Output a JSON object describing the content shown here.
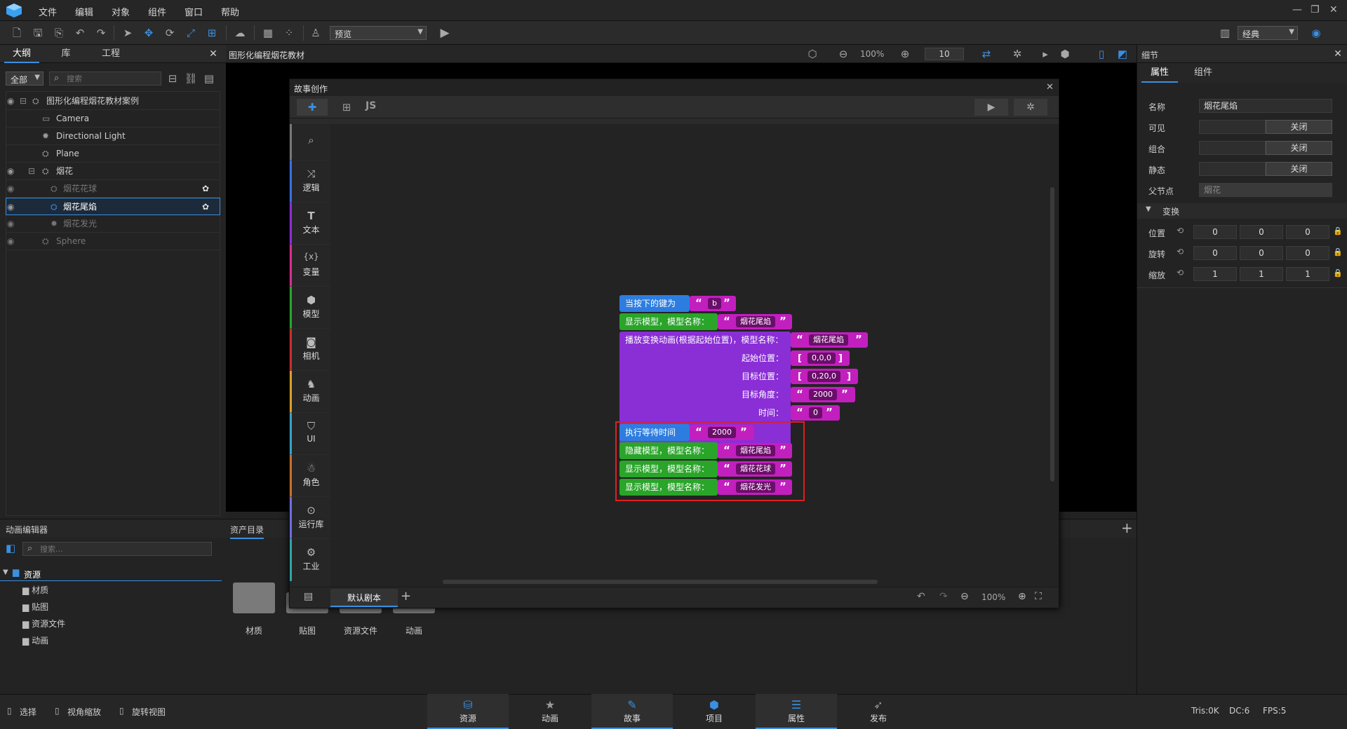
{
  "menu": [
    "文件",
    "编辑",
    "对象",
    "组件",
    "窗口",
    "帮助"
  ],
  "toolbar": {
    "preview_label": "预览",
    "layout_label": "经典"
  },
  "left_panel": {
    "tabs": [
      "大纲",
      "库",
      "工程"
    ],
    "filter": "全部",
    "search_placeholder": "搜索",
    "tree": [
      {
        "label": "图形化编程烟花教材案例",
        "level": 0
      },
      {
        "label": "Camera",
        "level": 1
      },
      {
        "label": "Directional Light",
        "level": 1
      },
      {
        "label": "Plane",
        "level": 1
      },
      {
        "label": "烟花",
        "level": 1
      },
      {
        "label": "烟花花球",
        "level": 2
      },
      {
        "label": "烟花尾焰",
        "level": 2
      },
      {
        "label": "烟花发光",
        "level": 2
      },
      {
        "label": "Sphere",
        "level": 1
      }
    ]
  },
  "scene_header": {
    "title": "图形化编程烟花教材",
    "zoom": "100%",
    "grid_value": "10"
  },
  "story_dialog": {
    "title": "故事创作",
    "js_label": "JS",
    "categories": [
      "逻辑",
      "文本",
      "变量",
      "模型",
      "相机",
      "动画",
      "UI",
      "角色",
      "运行库",
      "工业"
    ],
    "blocks": {
      "on_key": "当按下的键为",
      "key_value": "b",
      "show_model": "显示模型，模型名称：",
      "tail_flame": "烟花尾焰",
      "play_anim": "播放变换动画(根据起始位置)，模型名称：",
      "start_pos": "起始位置：",
      "start_pos_value": "0,0,0",
      "target_pos": "目标位置：",
      "target_pos_value": "0,20,0",
      "target_angle": "目标角度：",
      "target_angle_value": "2000",
      "time": "时间：",
      "time_value": "0",
      "wait": "执行等待时间",
      "wait_value": "2000",
      "hide_model": "隐藏模型，模型名称：",
      "flower_ball": "烟花花球",
      "glow": "烟花发光"
    },
    "script_tab": "默认剧本",
    "zoom": "100%"
  },
  "right_panel": {
    "title": "细节",
    "tabs": [
      "属性",
      "组件"
    ],
    "name_label": "名称",
    "name_value": "烟花尾焰",
    "visible_label": "可见",
    "group_label": "组合",
    "static_label": "静态",
    "off_label": "关闭",
    "parent_label": "父节点",
    "parent_value": "烟花",
    "transform_label": "变换",
    "position_label": "位置",
    "rotation_label": "旋转",
    "scale_label": "缩放",
    "position": [
      "0",
      "0",
      "0"
    ],
    "rotation": [
      "0",
      "0",
      "0"
    ],
    "scale": [
      "1",
      "1",
      "1"
    ]
  },
  "anim_panel": {
    "title": "动画编辑器",
    "search_placeholder": "搜索..."
  },
  "assets": {
    "tab": "资产目录",
    "tree_root": "资源",
    "tree": [
      "材质",
      "贴图",
      "资源文件",
      "动画"
    ],
    "folders": [
      "材质",
      "贴图",
      "资源文件",
      "动画"
    ]
  },
  "status": {
    "select": "选择",
    "view_zoom": "视角缩放",
    "rotate_view": "旋转视图",
    "tris": "Tris:0K",
    "dc": "DC:6",
    "fps": "FPS:5"
  },
  "bottom_tabs": [
    "资源",
    "动画",
    "故事",
    "项目",
    "属性",
    "发布"
  ]
}
